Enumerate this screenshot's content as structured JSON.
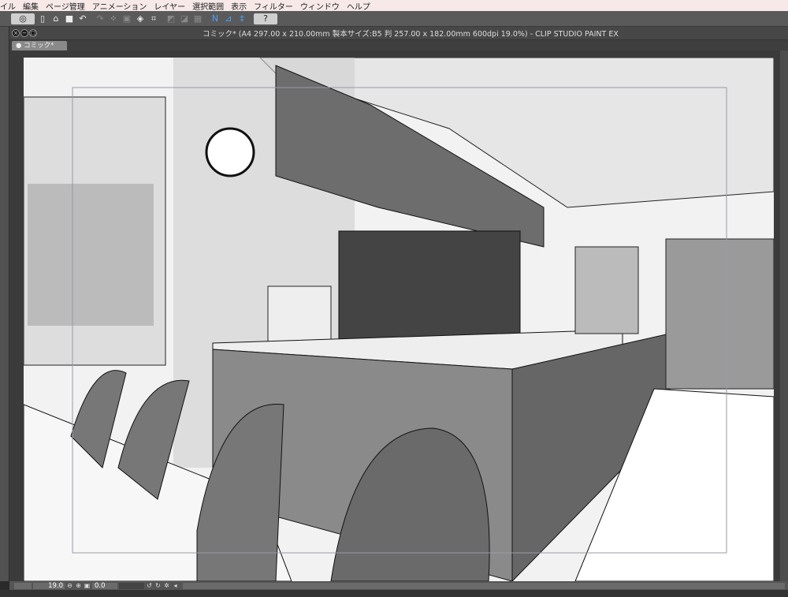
{
  "menu": [
    "イル",
    "編集",
    "ページ管理",
    "アニメーション",
    "レイヤー",
    "選択範囲",
    "表示",
    "フィルター",
    "ウィンドウ",
    "ヘルプ"
  ],
  "toolbar": {
    "icons": [
      "clip-studio-icon",
      "new-file-icon",
      "open-file-icon",
      "save-icon",
      "undo-icon",
      "redo-icon",
      "transform-icon",
      "selection-icon",
      "fill-icon",
      "fit-icon",
      "ruler-icon",
      "ruler2-icon",
      "grid-icon",
      "snap-ruler-icon",
      "snap-special-icon",
      "snap-grid-icon",
      "help-icon"
    ],
    "help_label": "?"
  },
  "window": {
    "title": "コミック* (A4 297.00 x 210.00mm 製本サイズ:B5 判 257.00 x 182.00mm 600dpi 19.0%)  - CLIP STUDIO PAINT EX",
    "tab": "● コミック*"
  },
  "status": {
    "zoom": "19.0",
    "rotation": "0.0"
  }
}
